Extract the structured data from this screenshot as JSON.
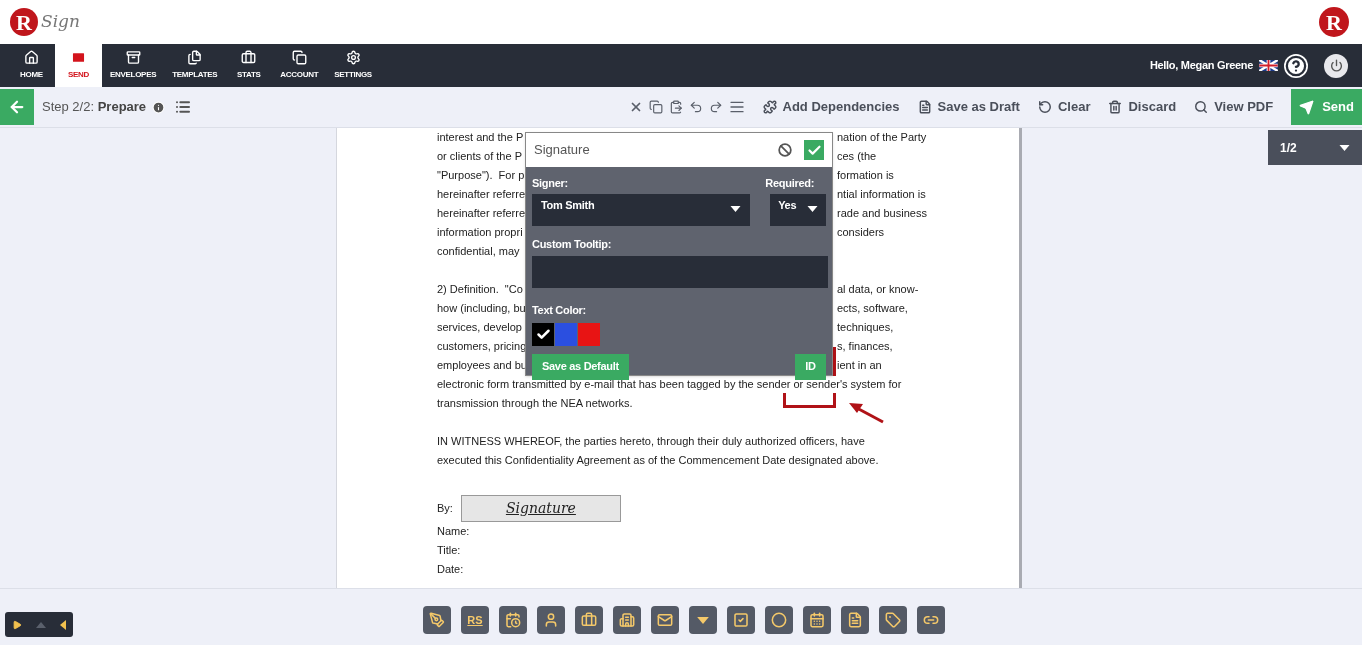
{
  "logo": {
    "mark": "R",
    "word": "Sign"
  },
  "brand_badge": "R",
  "nav": [
    {
      "label": "HOME",
      "selected": false
    },
    {
      "label": "SEND",
      "selected": true
    },
    {
      "label": "ENVELOPES",
      "selected": false
    },
    {
      "label": "TEMPLATES",
      "selected": false
    },
    {
      "label": "STATS",
      "selected": false
    },
    {
      "label": "ACCOUNT",
      "selected": false
    },
    {
      "label": "SETTINGS",
      "selected": false
    }
  ],
  "user": {
    "greeting": "Hello, Megan Greene"
  },
  "step": {
    "label": "Step 2/2:",
    "name": "Prepare"
  },
  "actions": [
    "Add Dependencies",
    "Save as Draft",
    "Clear",
    "Discard",
    "View PDF"
  ],
  "send": "Send",
  "page_indicator": "1/2",
  "document": {
    "lines": [
      {
        "kind": "split",
        "left": "interest and the P",
        "right": "nation of the Party"
      },
      {
        "kind": "split",
        "left": "or clients of the P",
        "right": "ces (the"
      },
      {
        "kind": "split",
        "left": "\"Purpose\").  For p",
        "right": "formation is"
      },
      {
        "kind": "split",
        "left": "hereinafter referre",
        "right": "ntial information is"
      },
      {
        "kind": "split",
        "left": "hereinafter referre",
        "right": "rade and business"
      },
      {
        "kind": "split",
        "left": "information propri",
        "right": "considers"
      },
      {
        "kind": "split",
        "left": "confidential, may"
      },
      {
        "kind": "blank"
      },
      {
        "kind": "split",
        "left": "2) Definition.  \"Co",
        "right": "al data, or know-"
      },
      {
        "kind": "split",
        "left": "how (including, bu",
        "right": "ects, software,"
      },
      {
        "kind": "split",
        "left": "services, develop",
        "right": "techniques,"
      },
      {
        "kind": "split",
        "left": "customers, pricing",
        "right": "s, finances,"
      },
      {
        "kind": "split",
        "left": "employees and bu",
        "right": "ient in an"
      },
      {
        "kind": "full",
        "text": "electronic form transmitted by e-mail that has been tagged by the sender or sender's system for"
      },
      {
        "kind": "full",
        "text": "transmission through the NEA networks."
      },
      {
        "kind": "blank"
      },
      {
        "kind": "full",
        "text": "IN WITNESS WHEREOF, the parties hereto, through their duly authorized officers, have"
      },
      {
        "kind": "full",
        "text": "executed this Confidentiality Agreement as of the Commencement Date designated above."
      },
      {
        "kind": "blank"
      },
      {
        "kind": "blank"
      }
    ],
    "by": "By:",
    "signature_field": "Signature",
    "fields": [
      "Name:",
      "Title:",
      "Date:"
    ]
  },
  "popup": {
    "title": "Signature",
    "signer_label": "Signer:",
    "signer": "Tom Smith",
    "required_label": "Required:",
    "required": "Yes",
    "tooltip_label": "Custom Tooltip:",
    "color_label": "Text Color:",
    "colors": [
      {
        "color": "#000000",
        "selected": true
      },
      {
        "color": "#2b4fe0",
        "selected": false
      },
      {
        "color": "#e81414",
        "selected": false
      }
    ],
    "save_default": "Save as Default",
    "id_button": "ID"
  },
  "tools_rs_label": "RS"
}
